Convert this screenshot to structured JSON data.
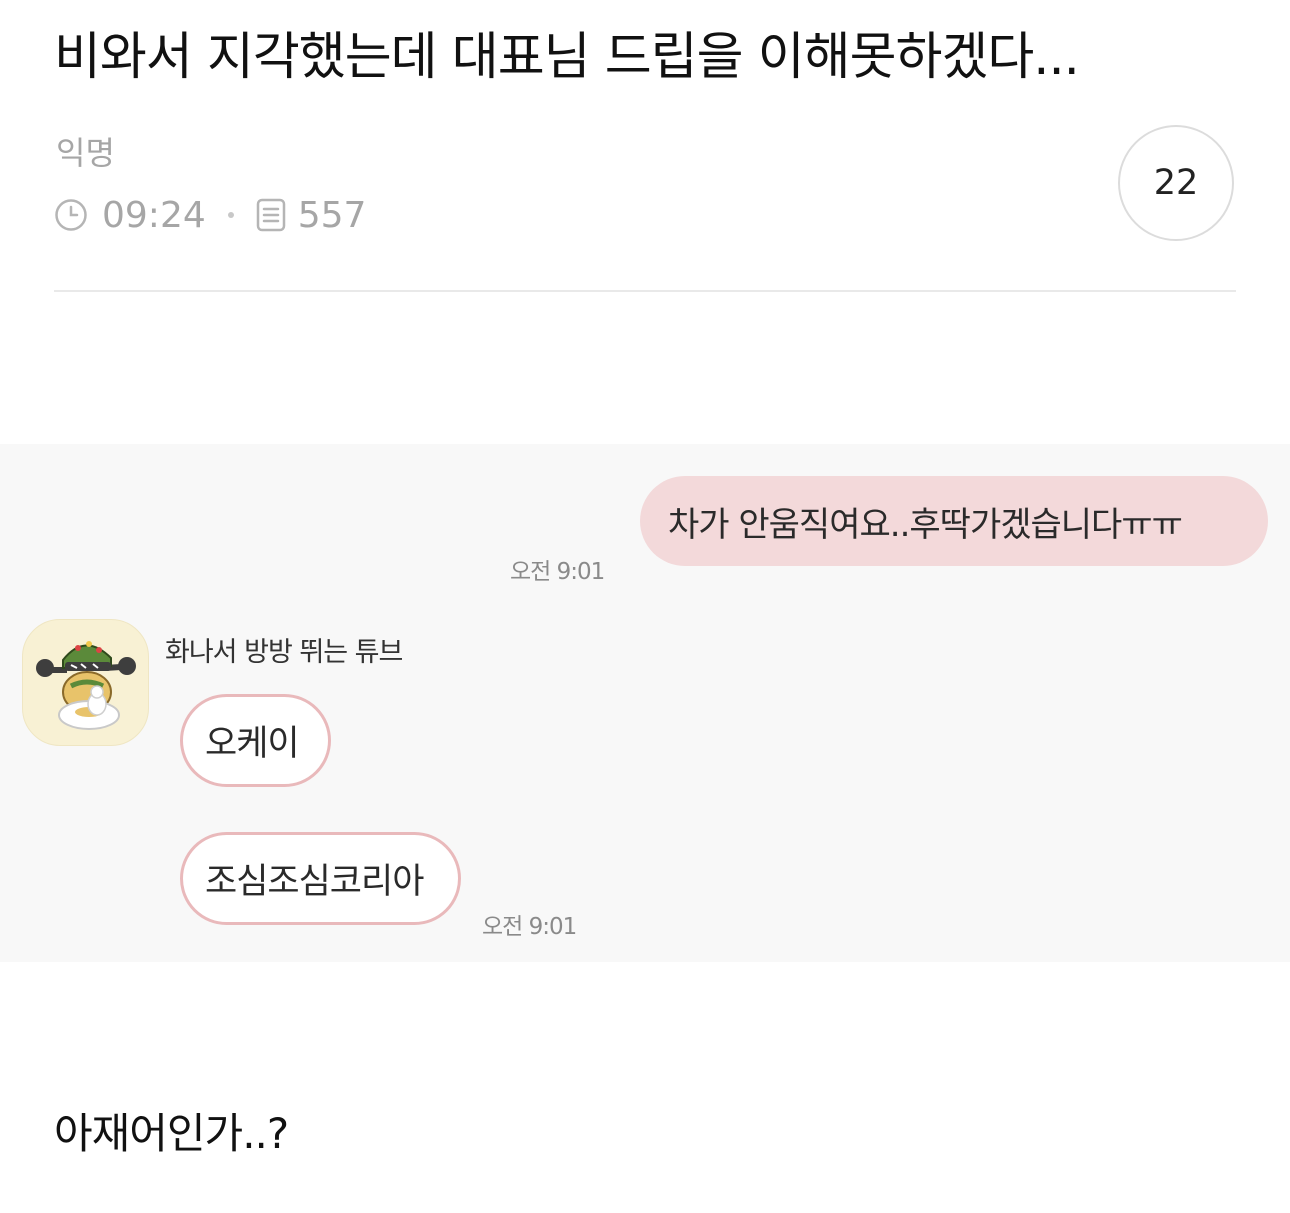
{
  "post": {
    "title": "비와서 지각했는데 대표님 드립을 이해못하겠다...",
    "author": "익명",
    "time": "09:24",
    "views": "557",
    "comment_count": "22",
    "body": "아재어인가..?"
  },
  "chat": {
    "my_message": "차가 안움직여요..후딱가겠습니다ㅠㅠ",
    "my_message_time": "오전 9:01",
    "sender_name": "화나서 방방 뛰는 튜브",
    "replies": [
      "오케이",
      "조심조심코리아"
    ],
    "reply_time": "오전 9:01"
  },
  "icons": {
    "clock": "clock-icon",
    "views": "document-icon",
    "avatar": "tube-character-avatar"
  },
  "colors": {
    "meta_gray": "#a6a6a6",
    "my_bubble": "#f3d9da",
    "other_bubble_border": "#e9b9bb",
    "chat_bg": "#f8f8f8"
  }
}
